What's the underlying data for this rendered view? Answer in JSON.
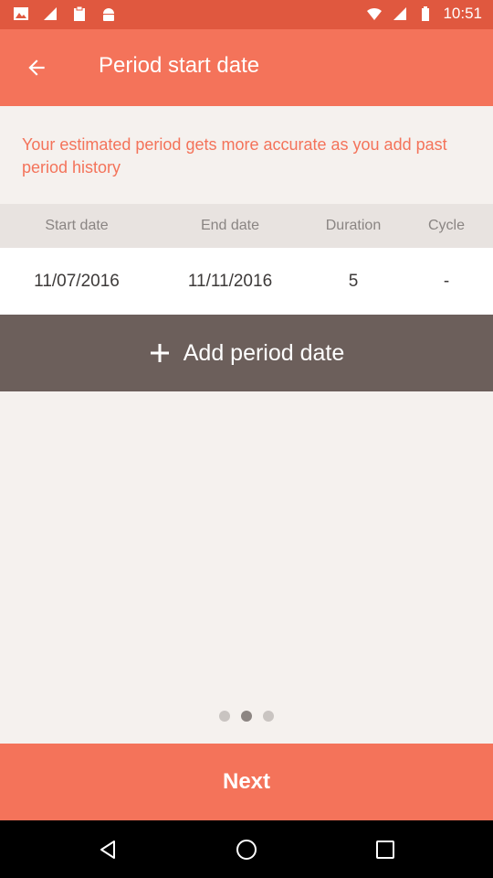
{
  "status_bar": {
    "time": "10:51",
    "left_icons": [
      "image-icon",
      "signal-strength-icon",
      "clipboard-icon",
      "android-icon"
    ],
    "right_icons": [
      "wifi-icon",
      "cell-signal-icon",
      "battery-icon"
    ]
  },
  "app_bar": {
    "title": "Period start date",
    "back_icon": "arrow-back-icon"
  },
  "info": {
    "text": "Your estimated period gets more accurate as you add past period history"
  },
  "table": {
    "headers": [
      "Start date",
      "End date",
      "Duration",
      "Cycle"
    ],
    "rows": [
      [
        "11/07/2016",
        "11/11/2016",
        "5",
        "-"
      ]
    ]
  },
  "add_button": {
    "label": "Add period date",
    "icon": "plus-icon"
  },
  "pager": {
    "count": 3,
    "active_index": 1
  },
  "next_button": {
    "label": "Next"
  },
  "colors": {
    "accent": "#f4735a",
    "status_bar": "#e0583f",
    "add_button": "#6c5f5b",
    "background": "#f5f1ee"
  }
}
